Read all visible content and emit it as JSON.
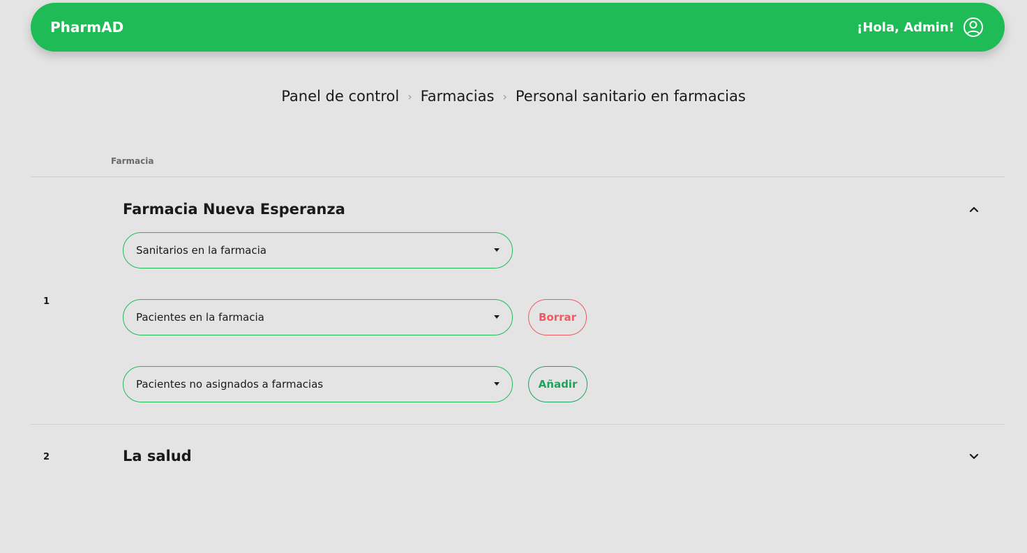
{
  "header": {
    "brand": "PharmAD",
    "greeting": "¡Hola, Admin!"
  },
  "breadcrumb": {
    "items": [
      "Panel de control",
      "Farmacias",
      "Personal sanitario en farmacias"
    ]
  },
  "table": {
    "column_header": "Farmacia",
    "rows": [
      {
        "number": "1",
        "name": "Farmacia Nueva Esperanza",
        "expanded": true,
        "selects": {
          "staff": "Sanitarios en la farmacia",
          "patients": "Pacientes en la farmacia",
          "unassigned": "Pacientes no asignados a farmacias"
        },
        "delete_label": "Borrar",
        "add_label": "Añadir"
      },
      {
        "number": "2",
        "name": "La salud",
        "expanded": false
      }
    ]
  },
  "colors": {
    "accent": "#1fbb57",
    "danger": "#ee5a62",
    "add": "#1fa35a",
    "background": "#e4e4e4"
  }
}
